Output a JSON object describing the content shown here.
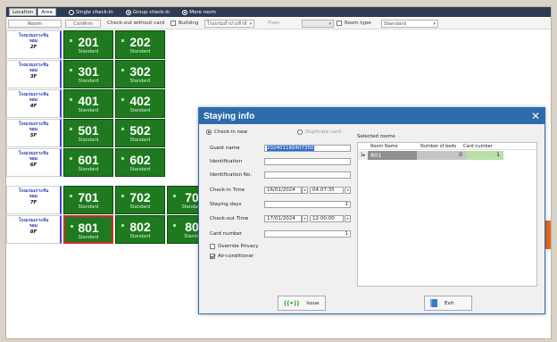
{
  "topbar": {
    "tabs": [
      {
        "label": "Location"
      },
      {
        "label": "Area"
      }
    ],
    "modes": [
      {
        "label": "Single check-in",
        "selected": false
      },
      {
        "label": "Group check-in",
        "selected": true
      },
      {
        "label": "More room",
        "selected": true
      }
    ]
  },
  "toolbar": {
    "room_btn": "Room",
    "confirm_btn": "Confirm",
    "checkout_label": "Check-out without card",
    "building_label": "Building",
    "building_value": "โรงแรมลำปางหัวจั",
    "floor_label": "Floor",
    "room_type_label": "Room type",
    "room_type_value": "Standard"
  },
  "floors": [
    {
      "hotel": "โรงแรมเกาะจัน",
      "sub": "จอม",
      "floor": "2F"
    },
    {
      "hotel": "โรงแรมเกาะจัน",
      "sub": "จอม",
      "floor": "3F"
    },
    {
      "hotel": "โรงแรมเกาะจัน",
      "sub": "จอม",
      "floor": "4F"
    },
    {
      "hotel": "โรงแรมเกาะจัน",
      "sub": "จอม",
      "floor": "5F"
    },
    {
      "hotel": "โรงแรมเกาะจัน",
      "sub": "จอม",
      "floor": "6F"
    },
    {
      "hotel": "โรงแรมเกาะจัน",
      "sub": "จอม",
      "floor": "7F"
    },
    {
      "hotel": "โรงแรมเกาะจัน",
      "sub": "จอม",
      "floor": "8F"
    }
  ],
  "rooms": [
    {
      "number": "201",
      "type": "Standard"
    },
    {
      "number": "202",
      "type": "Standard"
    },
    {
      "number": "301",
      "type": "Standard"
    },
    {
      "number": "302",
      "type": "Standard"
    },
    {
      "number": "401",
      "type": "Standard"
    },
    {
      "number": "402",
      "type": "Standard"
    },
    {
      "number": "501",
      "type": "Standard"
    },
    {
      "number": "502",
      "type": "Standard"
    },
    {
      "number": "601",
      "type": "Standard"
    },
    {
      "number": "602",
      "type": "Standard"
    },
    {
      "number": "701",
      "type": "Standard"
    },
    {
      "number": "702",
      "type": "Standard"
    },
    {
      "number": "70",
      "type": "Standard"
    },
    {
      "number": "801",
      "type": "Standard"
    },
    {
      "number": "802",
      "type": "Standard"
    },
    {
      "number": "80",
      "type": "Standa"
    }
  ],
  "dialog": {
    "title": "Staying info",
    "close_icon": "✕",
    "checkin_new": "Check-in new",
    "duplicate_card": "Duplicate card",
    "guest_name_label": "Guest name",
    "guest_name_value": "202401160407350",
    "identification_label": "Identification",
    "identification_no_label": "Identification No.",
    "checkin_time_label": "Check-in Time",
    "checkin_date": "16/01/2024",
    "checkin_clock": "04:07:35",
    "staying_days_label": "Staying days",
    "staying_days_value": "1",
    "checkout_time_label": "Check-out Time",
    "checkout_date": "17/01/2024",
    "checkout_clock": "12:00:00",
    "card_number_label": "Card number",
    "card_number_value": "1",
    "override_privacy": "Override Privacy",
    "air_conditioner": "Air-conditioner",
    "selected_rooms_label": "Selected rooms",
    "grid_headers": {
      "room_name": "Room Name",
      "beds": "Number of beds",
      "card": "Card number"
    },
    "grid_rows": [
      {
        "indicator": "1▸",
        "room": "801",
        "beds": "0",
        "card": "1"
      }
    ],
    "issue_btn": "Issue",
    "exit_btn": "Exit"
  }
}
